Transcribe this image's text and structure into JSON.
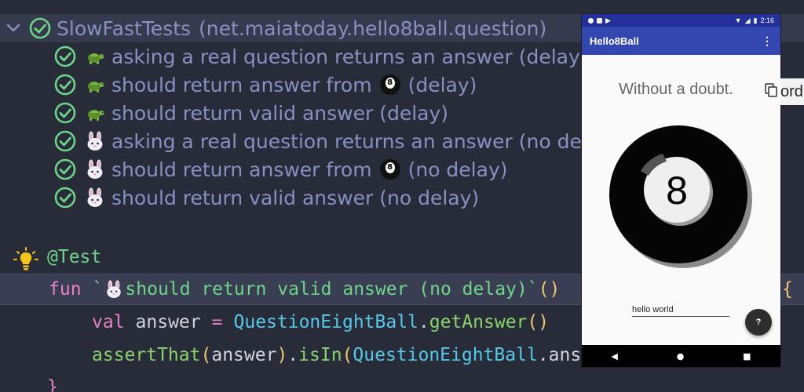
{
  "colors": {
    "background": "#282c38",
    "tree_text": "#8a8fc4",
    "check_green": "#6fd58b",
    "keyword_pink": "#e882c7",
    "class_cyan": "#56c8e8",
    "phone_primary": "#3446b0",
    "phone_status": "#25319a"
  },
  "test_tree": {
    "root": {
      "name": "SlowFastTests",
      "package": "(net.maiatoday.hello8ball.question)",
      "status_icon": "check-circle-icon",
      "expand_icon": "chevron-down-icon"
    },
    "items": [
      {
        "icon": "turtle-icon",
        "text": "asking a real question returns an answer (delay)",
        "suffix": ""
      },
      {
        "icon": "turtle-icon",
        "text": "should return answer from",
        "ball": true,
        "suffix": "(delay)"
      },
      {
        "icon": "turtle-icon",
        "text": "should return valid answer (delay)",
        "suffix": ""
      },
      {
        "icon": "rabbit-icon",
        "text": "asking a real question returns an answer (no dela",
        "suffix": ""
      },
      {
        "icon": "rabbit-icon",
        "text": "should return answer from",
        "ball": true,
        "suffix": "(no delay)"
      },
      {
        "icon": "rabbit-icon",
        "text": "should return valid answer (no delay)",
        "suffix": ""
      }
    ]
  },
  "code": {
    "annotation": "@Test",
    "fun_keyword": "fun",
    "fun_name_open": "`",
    "fun_name_rest": " should return valid answer (no delay)`",
    "fun_parens": "()",
    "brace_open": "{",
    "line2_val": "val",
    "line2_var": "answer",
    "line2_eq": "=",
    "line2_class": "QuestionEightBall",
    "line2_dot": ".",
    "line2_fn": "getAnswer",
    "line2_parens": "()",
    "line3_fn": "assertThat",
    "line3_paren_open": "(",
    "line3_arg": "answer",
    "line3_paren_close": ")",
    "line3_dot": ".",
    "line3_fn2": "isIn",
    "line3_paren_open2": "(",
    "line3_class": "QuestionEightBall",
    "line3_tail": ".ans",
    "closing_brace": "}"
  },
  "phone": {
    "status_time": "2:16",
    "app_title": "Hello8Ball",
    "menu_icon": "overflow-menu-icon",
    "answer_text": "Without a doubt.",
    "ball_number": "8",
    "input_value": "hello world",
    "fab_label": "?",
    "nav": {
      "back": "◀",
      "home": "●",
      "recents": "■"
    }
  },
  "side_tab_text": "ord"
}
